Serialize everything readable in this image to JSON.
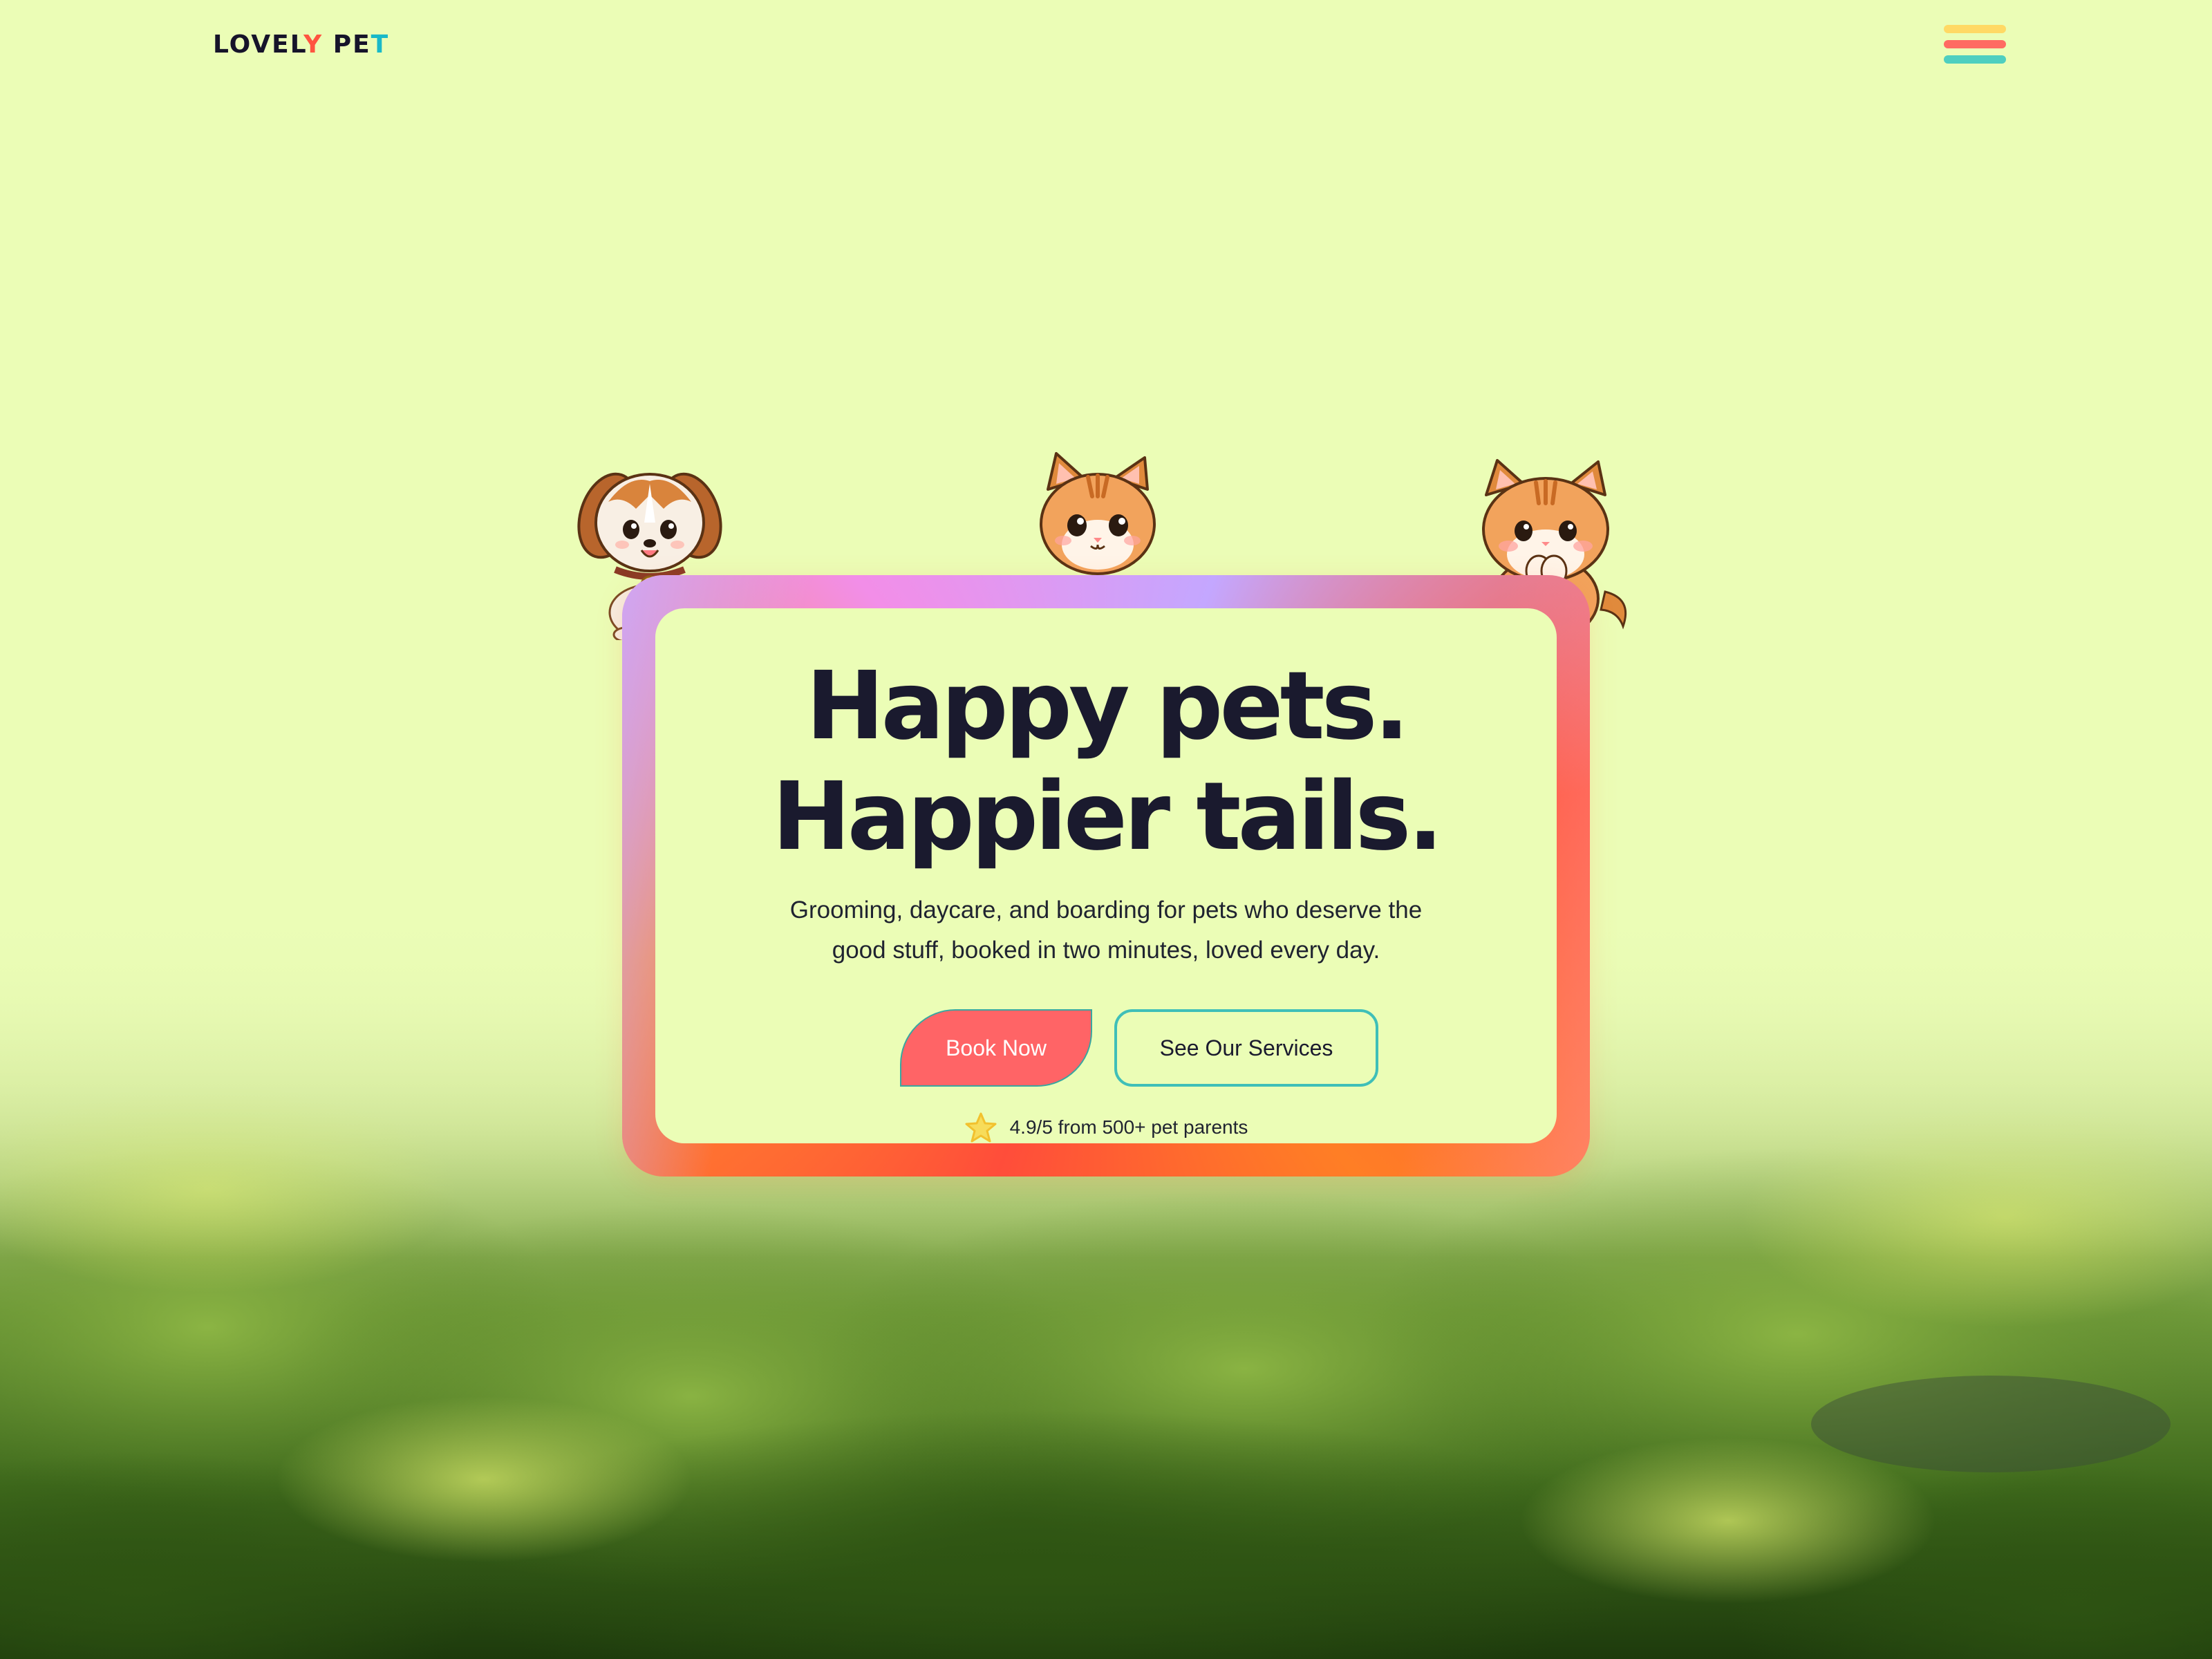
{
  "brand": {
    "name_part1": "LOVEL",
    "name_part2": "Y",
    "name_part3": " PE",
    "name_part4": "T",
    "accent_colors": [
      "#ff5540",
      "#19b9c8"
    ]
  },
  "header": {
    "menu_icon": "hamburger-menu-icon",
    "menu_colors": [
      "#ffd964",
      "#ff6b62",
      "#4ecfc0"
    ]
  },
  "hero": {
    "title_line1": "Happy pets.",
    "title_line2": "Happier tails.",
    "subtitle": "Grooming, daycare, and boarding for pets who deserve the good stuff, booked in two minutes, loved every day.",
    "primary_button": "Book Now",
    "secondary_button": "See Our Services",
    "rating_icon": "star-icon",
    "rating_text": "4.9/5 from 500+ pet parents"
  },
  "pets": [
    "puppy-illustration",
    "kitten-illustration",
    "cat-illustration"
  ],
  "colors": {
    "background": "#ebfdb6",
    "title": "#1a1a2e",
    "primary_button": "#ff6466",
    "secondary_border": "#3fbfb8"
  }
}
